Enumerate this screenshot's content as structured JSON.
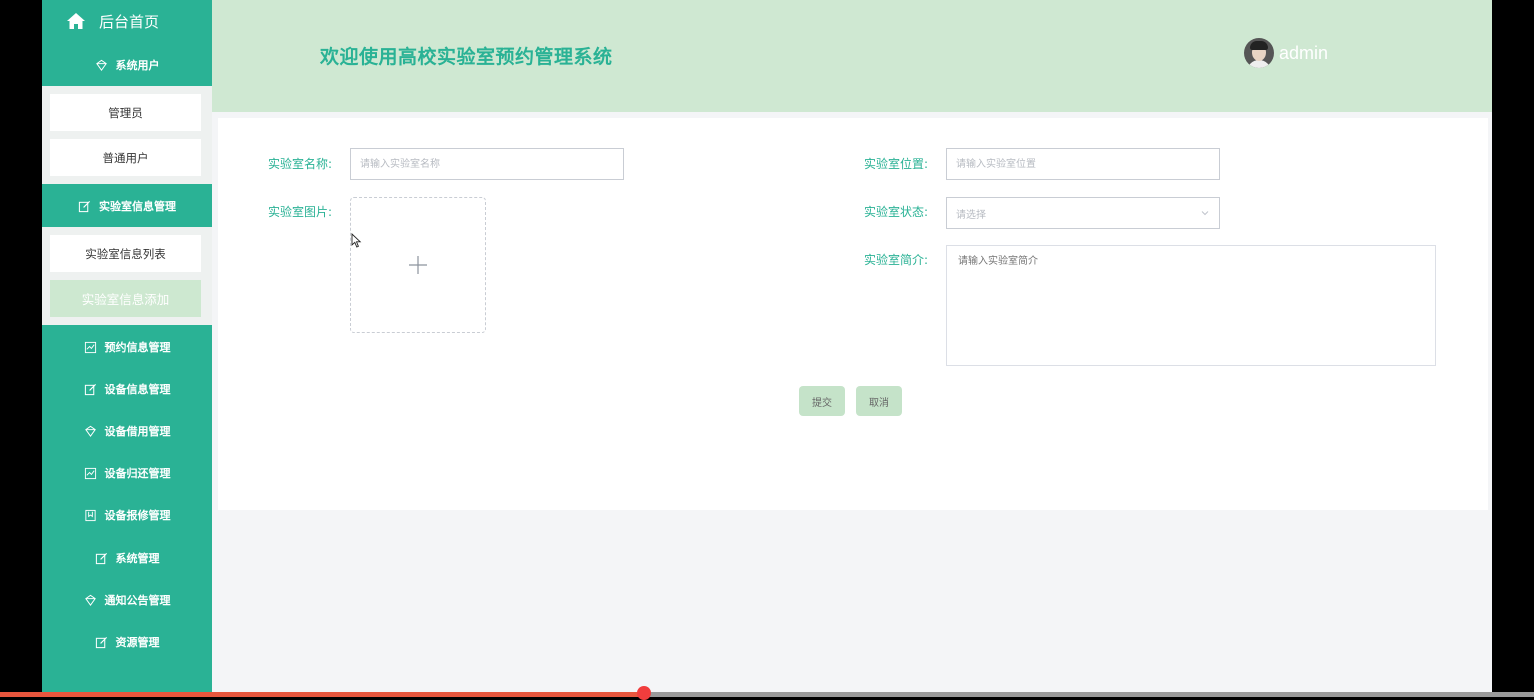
{
  "sidebar": {
    "home_label": "后台首页",
    "groups": [
      {
        "label": "系统用户",
        "icon": "diamond-icon",
        "items": [
          "管理员",
          "普通用户"
        ]
      },
      {
        "label": "实验室信息管理",
        "icon": "edit-icon",
        "items": [
          "实验室信息列表",
          "实验室信息添加"
        ],
        "active_item": "实验室信息添加"
      },
      {
        "label": "预约信息管理",
        "icon": "chart-icon"
      },
      {
        "label": "设备信息管理",
        "icon": "edit-icon"
      },
      {
        "label": "设备借用管理",
        "icon": "diamond-icon"
      },
      {
        "label": "设备归还管理",
        "icon": "chart-icon"
      },
      {
        "label": "设备报修管理",
        "icon": "bookmark-icon"
      },
      {
        "label": "系统管理",
        "icon": "edit-icon"
      },
      {
        "label": "通知公告管理",
        "icon": "diamond-icon"
      },
      {
        "label": "资源管理",
        "icon": "edit-icon"
      }
    ]
  },
  "header": {
    "title": "欢迎使用高校实验室预约管理系统",
    "username": "admin"
  },
  "form": {
    "name_label": "实验室名称:",
    "name_placeholder": "请输入实验室名称",
    "location_label": "实验室位置:",
    "location_placeholder": "请输入实验室位置",
    "image_label": "实验室图片:",
    "status_label": "实验室状态:",
    "status_placeholder": "请选择",
    "intro_label": "实验室简介:",
    "intro_placeholder": "请输入实验室简介",
    "submit_label": "提交",
    "cancel_label": "取消"
  },
  "player": {
    "progress": 0.42
  },
  "colors": {
    "primary": "#2ab295",
    "header_bg": "#cfe8d2",
    "button_bg": "#c5e3c9"
  }
}
